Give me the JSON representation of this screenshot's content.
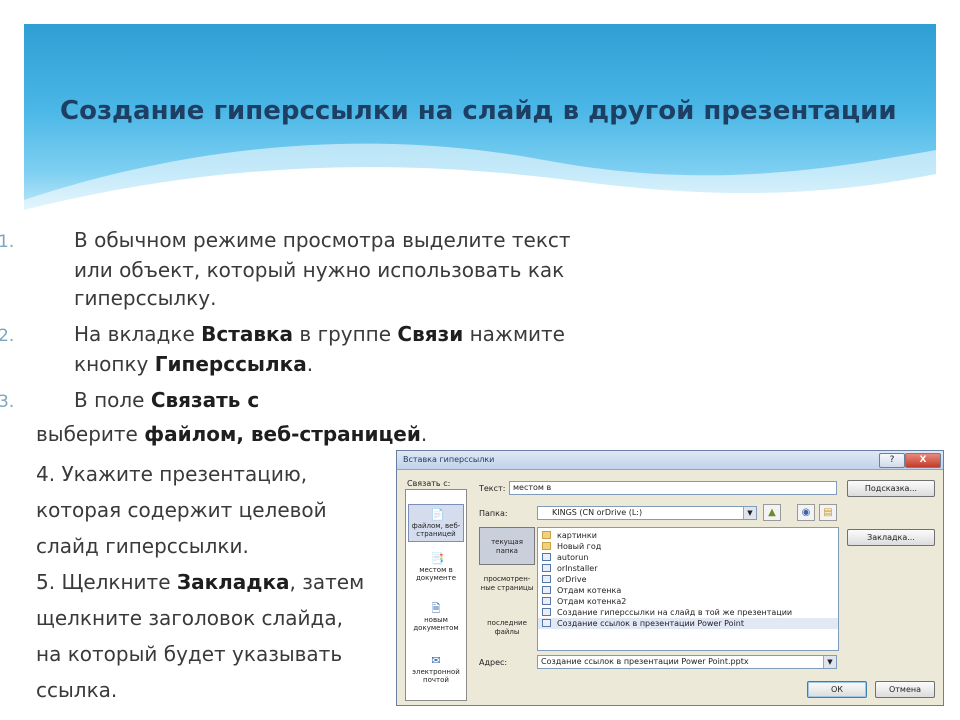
{
  "slide": {
    "title": "Создание гиперссылки на слайд в другой презентации",
    "steps": [
      {
        "num": "1.",
        "text": "В обычном режиме просмотра выделите текст или объект, который нужно использовать как гиперссылку."
      },
      {
        "num": "2.",
        "pre": "На вкладке ",
        "b1": "Вставка",
        "mid": " в группе ",
        "b2": "Связи",
        "post": " нажмите кнопку ",
        "b3": "Гиперссылка",
        "end": "."
      },
      {
        "num": "3.",
        "pre": "В поле ",
        "b1": "Связать с"
      }
    ],
    "line3b": {
      "pre": "выберите ",
      "bold": "файлом, веб-страницей",
      "end": "."
    },
    "line4": [
      "4. Укажите презентацию,",
      "которая содержит целевой",
      "слайд гиперссылки."
    ],
    "line5": {
      "pre": "5. Щелкните ",
      "bold": "Закладка",
      "rest1": ", затем",
      "rest2": "щелкните заголовок слайда,",
      "rest3": "на который будет указывать",
      "rest4": "ссылка."
    }
  },
  "dialog": {
    "title": "Вставка гиперссылки",
    "help_btn": "?",
    "close_btn": "X",
    "link_to_label": "Связать с:",
    "link_items": [
      {
        "label": "файлом, веб-страницей",
        "icon": "📄"
      },
      {
        "label": "местом в документе",
        "icon": "📑"
      },
      {
        "label": "новым документом",
        "icon": "🗎"
      },
      {
        "label": "электронной почтой",
        "icon": "✉"
      }
    ],
    "text_label": "Текст:",
    "text_value": "местом в",
    "tooltip_btn": "Подсказка...",
    "folder_label": "Папка:",
    "folder_value": "KINGS (CN orDrive (L:)",
    "bookmark_btn": "Закладка...",
    "side_buttons": [
      "текущая папка",
      "просмотрен-ные страницы",
      "последние файлы"
    ],
    "files": [
      {
        "name": "картинки",
        "type": "folder"
      },
      {
        "name": "Новый год",
        "type": "folder"
      },
      {
        "name": "autorun",
        "type": "file"
      },
      {
        "name": "orInstaller",
        "type": "file"
      },
      {
        "name": "orDrive",
        "type": "file"
      },
      {
        "name": "Отдам котенка",
        "type": "ppt"
      },
      {
        "name": "Отдам котенка2",
        "type": "ppt"
      },
      {
        "name": "Создание гиперссылки на слайд в той же презентации",
        "type": "ppt"
      },
      {
        "name": "Создание ссылок в презентации Power Point",
        "type": "ppt"
      }
    ],
    "address_label": "Адрес:",
    "address_value": "Создание ссылок в презентации Power Point.pptx",
    "ok_btn": "ОК",
    "cancel_btn": "Отмена"
  }
}
